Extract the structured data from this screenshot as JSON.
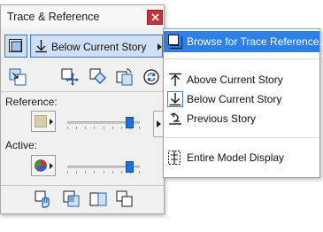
{
  "palette": {
    "title": "Trace & Reference",
    "close_icon": "close-icon",
    "reference_dropdown": {
      "label": "Below Current Story",
      "icon": "down-arrow-story-icon"
    },
    "reference_label": "Reference:",
    "active_label": "Active:",
    "colors": {
      "accent": "#2f80e6",
      "close_button": "#c6323a",
      "reference_swatch": "#d4cfa6"
    },
    "reference_slider_level": 0.85,
    "active_slider_level": 0.85
  },
  "menu": {
    "items": [
      {
        "label": "Browse for Trace Reference...",
        "icon": "browse-icon",
        "highlighted": true
      },
      {
        "label": "Above Current Story",
        "icon": "above-story-icon"
      },
      {
        "label": "Below Current Story",
        "icon": "below-story-icon"
      },
      {
        "label": "Previous Story",
        "icon": "previous-story-icon"
      },
      {
        "label": "Entire Model Display",
        "icon": "model-display-icon"
      }
    ]
  }
}
